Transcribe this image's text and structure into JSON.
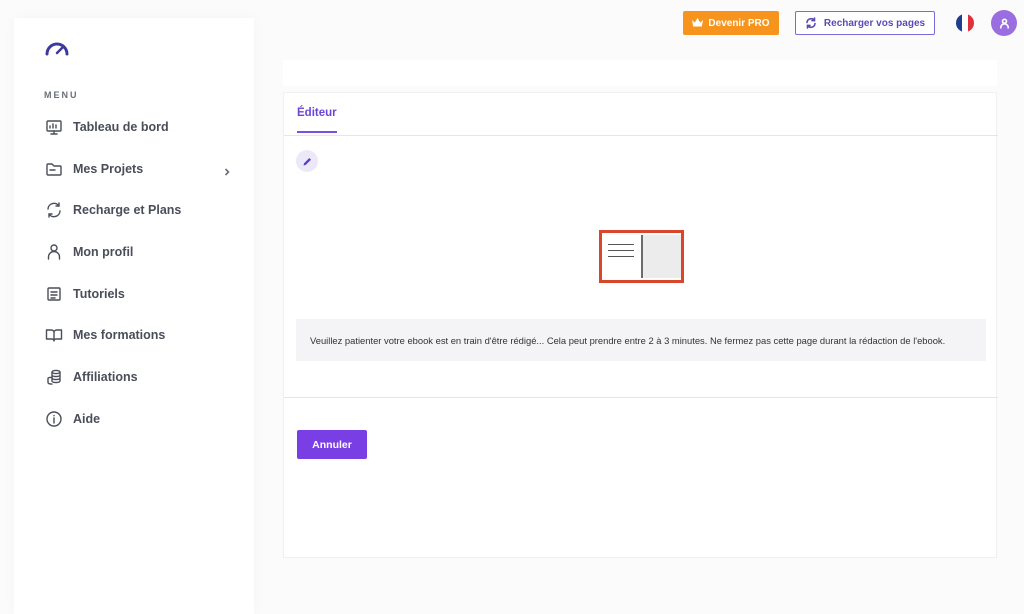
{
  "colors": {
    "accent": "#7a3fe4",
    "pro_orange": "#f7941d",
    "book_border": "#d9462b"
  },
  "sidebar": {
    "logo_icon": "gauge-logo-icon",
    "menu_title": "MENU",
    "items": [
      {
        "label": "Tableau de bord",
        "icon": "presentation-board-icon"
      },
      {
        "label": "Mes Projets",
        "icon": "folder-icon",
        "has_submenu": true
      },
      {
        "label": "Recharge et Plans",
        "icon": "refresh-icon"
      },
      {
        "label": "Mon profil",
        "icon": "user-icon"
      },
      {
        "label": "Tutoriels",
        "icon": "document-list-icon"
      },
      {
        "label": "Mes formations",
        "icon": "open-book-icon"
      },
      {
        "label": "Affiliations",
        "icon": "coins-icon"
      },
      {
        "label": "Aide",
        "icon": "info-icon"
      }
    ]
  },
  "header": {
    "pro_button": "Devenir PRO",
    "reload_button": "Recharger vos pages",
    "language_flag": "france-flag-icon",
    "avatar_icon": "user-avatar-icon"
  },
  "main": {
    "tab_editor": "Éditeur",
    "edit_icon": "pencil-icon",
    "illustration_icon": "open-book-illustration-icon",
    "notice": "Veuillez patienter votre ebook est en train d'être rédigé... Cela peut prendre entre 2 à 3 minutes. Ne fermez pas cette page durant la rédaction de l'ebook.",
    "cancel_button": "Annuler"
  }
}
